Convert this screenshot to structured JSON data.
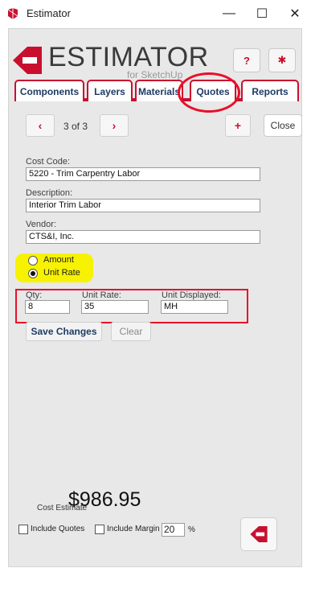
{
  "window": {
    "title": "Estimator",
    "controls": {
      "minimize": "—",
      "maximize": "☐",
      "close": "✕"
    }
  },
  "header": {
    "logo_text": "ESTIMATOR",
    "logo_sub": "for SketchUp",
    "help_label": "?",
    "settings_label": "✱"
  },
  "tabs": [
    {
      "label": "Components"
    },
    {
      "label": "Layers"
    },
    {
      "label": "Materials"
    },
    {
      "label": "Quotes"
    },
    {
      "label": "Reports"
    }
  ],
  "active_tab": "Quotes",
  "nav": {
    "prev_label": "‹",
    "next_label": "›",
    "position": "3 of 3",
    "add_label": "+",
    "close_label": "Close"
  },
  "form": {
    "cost_code_label": "Cost Code:",
    "cost_code_value": "5220 - Trim Carpentry Labor",
    "description_label": "Description:",
    "description_value": "Interior Trim Labor",
    "vendor_label": "Vendor:",
    "vendor_value": "CTS&I, Inc.",
    "radio_amount_label": "Amount",
    "radio_unit_rate_label": "Unit Rate",
    "selected_radio": "Unit Rate",
    "qty_label": "Qty:",
    "qty_value": "8",
    "unit_rate_label": "Unit Rate:",
    "unit_rate_value": "35",
    "unit_displayed_label": "Unit Displayed:",
    "unit_displayed_value": "MH"
  },
  "actions": {
    "save_label": "Save Changes",
    "clear_label": "Clear"
  },
  "footer": {
    "cost_estimate_label": "Cost Estimate",
    "cost_estimate_value": "$986.95",
    "include_quotes_label": "Include Quotes",
    "include_margin_label": "Include Margin",
    "margin_value": "20",
    "percent_label": "%"
  },
  "colors": {
    "brand_red": "#c8102e",
    "tab_text": "#1f3b64",
    "annotation_red": "#e8102a",
    "highlight_yellow": "#f7f200"
  }
}
